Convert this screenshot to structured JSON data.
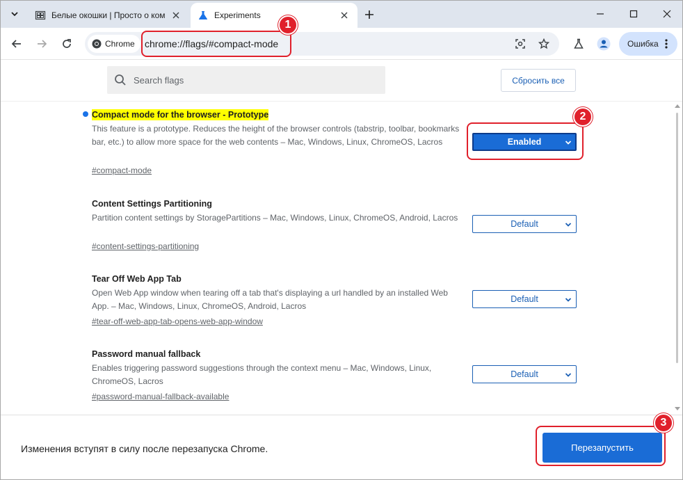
{
  "tabs": [
    {
      "title": "Белые окошки | Просто о ком",
      "active": false
    },
    {
      "title": "Experiments",
      "active": true
    }
  ],
  "toolbar": {
    "chip_label": "Chrome",
    "url": "chrome://flags/#compact-mode",
    "profile_error_label": "Ошибка"
  },
  "search": {
    "placeholder": "Search flags",
    "reset_label": "Сбросить все"
  },
  "flags": [
    {
      "name": "Compact mode for the browser - Prototype",
      "description": "This feature is a prototype. Reduces the height of the browser controls (tabstrip, toolbar, bookmarks bar, etc.) to allow more space for the web contents – Mac, Windows, Linux, ChromeOS, Lacros",
      "link": "#compact-mode",
      "value": "Enabled",
      "modified": true
    },
    {
      "name": "Content Settings Partitioning",
      "description": "Partition content settings by StoragePartitions – Mac, Windows, Linux, ChromeOS, Android, Lacros",
      "link": "#content-settings-partitioning",
      "value": "Default",
      "modified": false
    },
    {
      "name": "Tear Off Web App Tab",
      "description": "Open Web App window when tearing off a tab that's displaying a url handled by an installed Web App. – Mac, Windows, Linux, ChromeOS, Android, Lacros",
      "link": "#tear-off-web-app-tab-opens-web-app-window",
      "value": "Default",
      "modified": false
    },
    {
      "name": "Password manual fallback",
      "description": "Enables triggering password suggestions through the context menu – Mac, Windows, Linux, ChromeOS, Lacros",
      "link": "#password-manual-fallback-available",
      "value": "Default",
      "modified": false
    }
  ],
  "footer": {
    "message": "Изменения вступят в силу после перезапуска Chrome.",
    "relaunch_label": "Перезапустить"
  },
  "annotations": [
    "1",
    "2",
    "3"
  ],
  "colors": {
    "accent": "#1a6cd6",
    "annotation": "#e0202b",
    "highlight": "#ffff00"
  }
}
